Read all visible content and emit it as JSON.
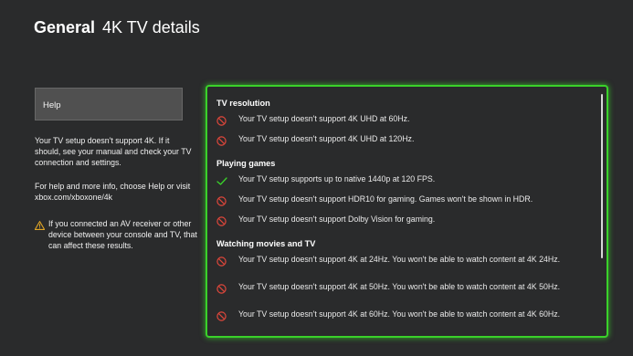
{
  "header": {
    "section": "General",
    "title": "4K TV details"
  },
  "help": {
    "button_label": "Help",
    "paragraph1": "Your TV setup doesn't support 4K. If it should, see your manual and check your TV connection and settings.",
    "paragraph2": "For help and more info, choose Help or visit xbox.com/xboxone/4k",
    "warning": "If you connected an AV receiver or other device between your console and TV, that can affect these results."
  },
  "colors": {
    "accent": "#3ad22a",
    "error": "#e0473b",
    "success": "#3ad22a",
    "warning": "#e0a526"
  },
  "panel": {
    "categories": [
      {
        "title": "TV resolution",
        "items": [
          {
            "status": "unsupported",
            "icon": "no-entry-icon",
            "text": "Your TV setup doesn't support 4K UHD at 60Hz."
          },
          {
            "status": "unsupported",
            "icon": "no-entry-icon",
            "text": "Your TV setup doesn't support 4K UHD at 120Hz."
          }
        ]
      },
      {
        "title": "Playing games",
        "items": [
          {
            "status": "supported",
            "icon": "checkmark-icon",
            "text": "Your TV setup supports up to native 1440p at 120 FPS."
          },
          {
            "status": "unsupported",
            "icon": "no-entry-icon",
            "text": "Your TV setup doesn't support HDR10 for gaming. Games won't be shown in HDR."
          },
          {
            "status": "unsupported",
            "icon": "no-entry-icon",
            "text": "Your TV setup doesn't support Dolby Vision for gaming."
          }
        ]
      },
      {
        "title": "Watching movies and TV",
        "items": [
          {
            "status": "unsupported",
            "icon": "no-entry-icon",
            "text": "Your TV setup doesn't support 4K at 24Hz. You won't be able to watch content at 4K 24Hz."
          },
          {
            "status": "unsupported",
            "icon": "no-entry-icon",
            "text": "Your TV setup doesn't support 4K at 50Hz. You won't be able to watch content at 4K 50Hz."
          },
          {
            "status": "unsupported",
            "icon": "no-entry-icon",
            "text": "Your TV setup doesn't support 4K at 60Hz. You won't be able to watch content at 4K 60Hz."
          }
        ]
      }
    ]
  }
}
